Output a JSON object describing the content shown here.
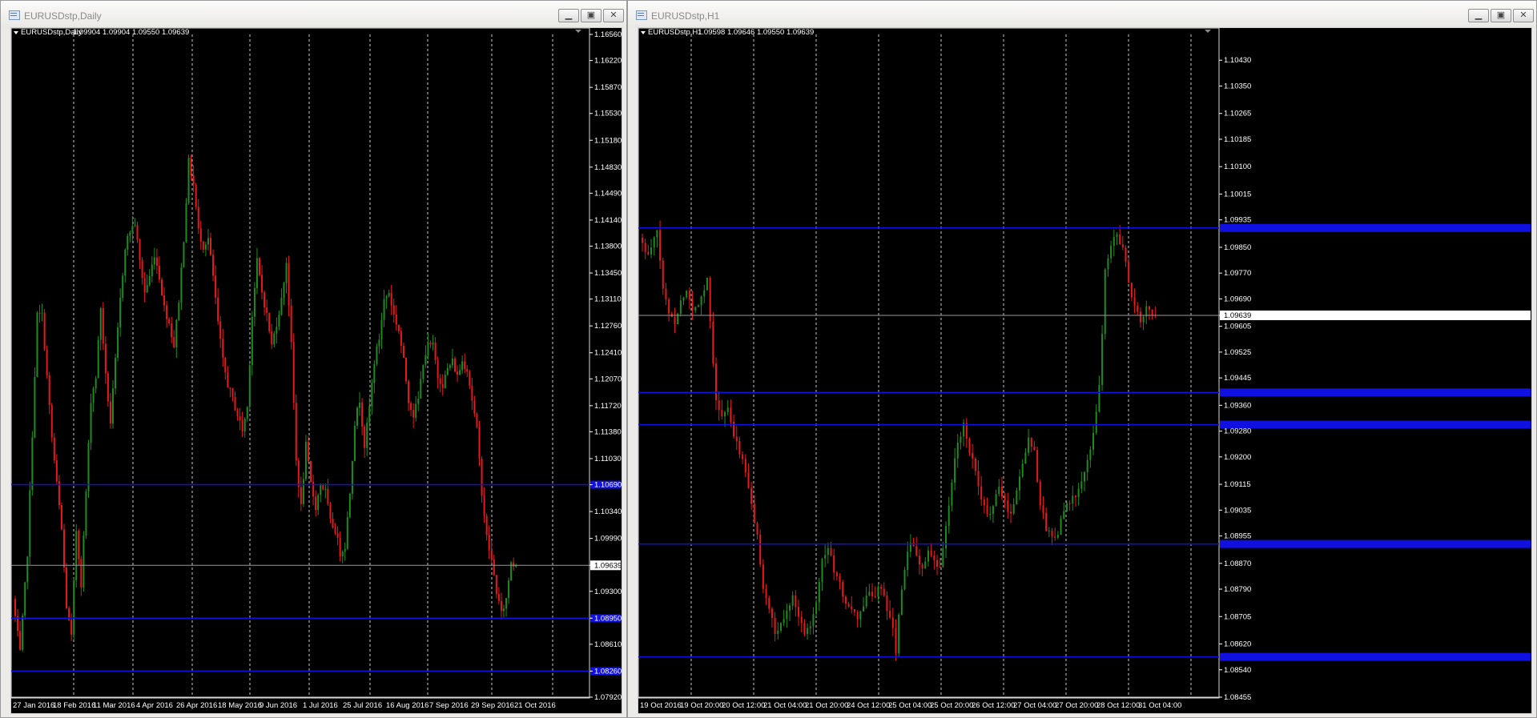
{
  "colors": {
    "bg": "#000000",
    "grid": "#c8c8c8",
    "bull": "#1f8c1f",
    "bear": "#e8191a",
    "level": "#1010e0",
    "axis_text": "#ffffff",
    "price_line": "#9a9a9a"
  },
  "icons": {
    "window": "chart-window-icon",
    "minimize": "minimize-icon",
    "maximize": "maximize-icon",
    "close": "close-icon",
    "menu": "triangle-down-icon",
    "scroll": "chart-shift-icon"
  },
  "windows": [
    {
      "title": "EURUSDstp,Daily",
      "header_symbol": "EURUSDstp,Daily",
      "header_prices": "1.09904 1.09904 1.09550 1.09639"
    },
    {
      "title": "EURUSDstp,H1",
      "header_symbol": "EURUSDstp,H1",
      "header_prices": "1.09598 1.09646 1.09550 1.09639"
    }
  ],
  "chart_data": [
    {
      "type": "candlestick",
      "symbol": "EURUSDstp",
      "timeframe": "Daily",
      "y_ticks": [
        "1.16560",
        "1.16220",
        "1.15870",
        "1.15530",
        "1.15180",
        "1.14830",
        "1.14490",
        "1.14140",
        "1.13800",
        "1.13450",
        "1.13110",
        "1.12760",
        "1.12410",
        "1.12070",
        "1.11720",
        "1.11380",
        "1.11030",
        "1.10690",
        "1.10340",
        "1.09990",
        "1.09639",
        "1.09300",
        "1.08950",
        "1.08610",
        "1.08260",
        "1.07920"
      ],
      "x_ticks": [
        "27 Jan 2016",
        "18 Feb 2016",
        "11 Mar 2016",
        "4 Apr 2016",
        "26 Apr 2016",
        "18 May 2016",
        "9 Jun 2016",
        "1 Jul 2016",
        "25 Jul 2016",
        "16 Aug 2016",
        "7 Sep 2016",
        "29 Sep 2016",
        "21 Oct 2016"
      ],
      "ylim": [
        1.0792,
        1.1656
      ],
      "current_price": 1.09639,
      "levels": [
        1.1069,
        1.0895,
        1.0826
      ],
      "path": [
        [
          0,
          1.092
        ],
        [
          3,
          1.085
        ],
        [
          6,
          1.098
        ],
        [
          10,
          1.129
        ],
        [
          12,
          1.129
        ],
        [
          16,
          1.113
        ],
        [
          20,
          1.101
        ],
        [
          22,
          1.091
        ],
        [
          24,
          1.087
        ],
        [
          26,
          1.101
        ],
        [
          28,
          1.094
        ],
        [
          30,
          1.106
        ],
        [
          32,
          1.118
        ],
        [
          34,
          1.121
        ],
        [
          36,
          1.13
        ],
        [
          38,
          1.121
        ],
        [
          40,
          1.115
        ],
        [
          42,
          1.123
        ],
        [
          44,
          1.131
        ],
        [
          46,
          1.138
        ],
        [
          48,
          1.14
        ],
        [
          50,
          1.141
        ],
        [
          52,
          1.136
        ],
        [
          54,
          1.132
        ],
        [
          56,
          1.134
        ],
        [
          58,
          1.137
        ],
        [
          60,
          1.134
        ],
        [
          62,
          1.13
        ],
        [
          64,
          1.128
        ],
        [
          66,
          1.125
        ],
        [
          68,
          1.131
        ],
        [
          70,
          1.139
        ],
        [
          72,
          1.149
        ],
        [
          74,
          1.146
        ],
        [
          76,
          1.14
        ],
        [
          78,
          1.138
        ],
        [
          80,
          1.139
        ],
        [
          82,
          1.134
        ],
        [
          84,
          1.128
        ],
        [
          86,
          1.123
        ],
        [
          88,
          1.12
        ],
        [
          90,
          1.118
        ],
        [
          92,
          1.116
        ],
        [
          94,
          1.114
        ],
        [
          96,
          1.117
        ],
        [
          98,
          1.129
        ],
        [
          100,
          1.136
        ],
        [
          102,
          1.132
        ],
        [
          104,
          1.129
        ],
        [
          106,
          1.125
        ],
        [
          108,
          1.128
        ],
        [
          110,
          1.131
        ],
        [
          112,
          1.136
        ],
        [
          114,
          1.125
        ],
        [
          116,
          1.11
        ],
        [
          118,
          1.104
        ],
        [
          120,
          1.112
        ],
        [
          122,
          1.107
        ],
        [
          124,
          1.104
        ],
        [
          126,
          1.107
        ],
        [
          128,
          1.106
        ],
        [
          130,
          1.102
        ],
        [
          132,
          1.101
        ],
        [
          134,
          1.098
        ],
        [
          136,
          1.099
        ],
        [
          138,
          1.106
        ],
        [
          140,
          1.115
        ],
        [
          142,
          1.118
        ],
        [
          144,
          1.112
        ],
        [
          146,
          1.117
        ],
        [
          148,
          1.123
        ],
        [
          150,
          1.126
        ],
        [
          152,
          1.131
        ],
        [
          154,
          1.132
        ],
        [
          156,
          1.129
        ],
        [
          158,
          1.127
        ],
        [
          160,
          1.123
        ],
        [
          162,
          1.118
        ],
        [
          164,
          1.116
        ],
        [
          166,
          1.118
        ],
        [
          168,
          1.123
        ],
        [
          170,
          1.125
        ],
        [
          172,
          1.125
        ],
        [
          174,
          1.121
        ],
        [
          176,
          1.12
        ],
        [
          178,
          1.122
        ],
        [
          180,
          1.123
        ],
        [
          182,
          1.121
        ],
        [
          184,
          1.123
        ],
        [
          186,
          1.122
        ],
        [
          188,
          1.118
        ],
        [
          190,
          1.114
        ],
        [
          192,
          1.106
        ],
        [
          194,
          1.1
        ],
        [
          196,
          1.097
        ],
        [
          198,
          1.093
        ],
        [
          200,
          1.09
        ],
        [
          202,
          1.092
        ],
        [
          204,
          1.097
        ],
        [
          205,
          1.0964
        ]
      ]
    },
    {
      "type": "candlestick",
      "symbol": "EURUSDstp",
      "timeframe": "H1",
      "y_ticks": [
        "1.10430",
        "1.10350",
        "1.10265",
        "1.10185",
        "1.10100",
        "1.10015",
        "1.09935",
        "1.09850",
        "1.09770",
        "1.09690",
        "1.09639",
        "1.09605",
        "1.09525",
        "1.09445",
        "1.09360",
        "1.09280",
        "1.09200",
        "1.09115",
        "1.09035",
        "1.08955",
        "1.08870",
        "1.08790",
        "1.08705",
        "1.08620",
        "1.08540",
        "1.08455"
      ],
      "x_ticks": [
        "19 Oct 2016",
        "19 Oct 20:00",
        "20 Oct 12:00",
        "21 Oct 04:00",
        "21 Oct 20:00",
        "24 Oct 12:00",
        "25 Oct 04:00",
        "25 Oct 20:00",
        "26 Oct 12:00",
        "27 Oct 04:00",
        "27 Oct 20:00",
        "28 Oct 12:00",
        "31 Oct 04:00"
      ],
      "ylim": [
        1.08455,
        1.1051
      ],
      "current_price": 1.09639,
      "levels": [
        1.0991,
        1.094,
        1.093,
        1.0893,
        1.0858
      ],
      "path": [
        [
          0,
          1.0988
        ],
        [
          3,
          1.0982
        ],
        [
          6,
          1.099
        ],
        [
          8,
          1.0972
        ],
        [
          10,
          1.0965
        ],
        [
          12,
          1.0962
        ],
        [
          14,
          1.0968
        ],
        [
          16,
          1.0972
        ],
        [
          18,
          1.0965
        ],
        [
          20,
          1.0968
        ],
        [
          22,
          1.0972
        ],
        [
          23,
          1.0976
        ],
        [
          24,
          1.0962
        ],
        [
          26,
          1.0938
        ],
        [
          28,
          1.0932
        ],
        [
          30,
          1.0935
        ],
        [
          32,
          1.0926
        ],
        [
          34,
          1.0922
        ],
        [
          36,
          1.0915
        ],
        [
          38,
          1.0905
        ],
        [
          40,
          1.0895
        ],
        [
          42,
          1.088
        ],
        [
          44,
          1.0873
        ],
        [
          46,
          1.0865
        ],
        [
          48,
          1.0868
        ],
        [
          50,
          1.0872
        ],
        [
          52,
          1.0878
        ],
        [
          54,
          1.087
        ],
        [
          56,
          1.0866
        ],
        [
          58,
          1.0868
        ],
        [
          60,
          1.0876
        ],
        [
          62,
          1.0888
        ],
        [
          64,
          1.0892
        ],
        [
          66,
          1.0885
        ],
        [
          68,
          1.088
        ],
        [
          70,
          1.0875
        ],
        [
          72,
          1.0872
        ],
        [
          74,
          1.087
        ],
        [
          76,
          1.0874
        ],
        [
          78,
          1.0878
        ],
        [
          80,
          1.0877
        ],
        [
          82,
          1.088
        ],
        [
          84,
          1.0872
        ],
        [
          86,
          1.0866
        ],
        [
          87,
          1.086
        ],
        [
          88,
          1.087
        ],
        [
          90,
          1.0886
        ],
        [
          92,
          1.0893
        ],
        [
          94,
          1.089
        ],
        [
          96,
          1.0885
        ],
        [
          98,
          1.089
        ],
        [
          100,
          1.0887
        ],
        [
          102,
          1.0885
        ],
        [
          104,
          1.0898
        ],
        [
          106,
          1.0912
        ],
        [
          108,
          1.0925
        ],
        [
          110,
          1.093
        ],
        [
          112,
          1.0922
        ],
        [
          114,
          1.0915
        ],
        [
          116,
          1.0906
        ],
        [
          118,
          1.0902
        ],
        [
          120,
          1.0905
        ],
        [
          122,
          1.091
        ],
        [
          124,
          1.0906
        ],
        [
          126,
          1.0902
        ],
        [
          128,
          1.091
        ],
        [
          130,
          1.0918
        ],
        [
          132,
          1.0926
        ],
        [
          134,
          1.0922
        ],
        [
          136,
          1.0905
        ],
        [
          138,
          1.0898
        ],
        [
          140,
          1.0895
        ],
        [
          142,
          1.0897
        ],
        [
          144,
          1.0903
        ],
        [
          146,
          1.0906
        ],
        [
          148,
          1.0908
        ],
        [
          150,
          1.0912
        ],
        [
          152,
          1.0918
        ],
        [
          154,
          1.0928
        ],
        [
          156,
          1.0942
        ],
        [
          157,
          1.0958
        ],
        [
          158,
          1.0978
        ],
        [
          160,
          1.0985
        ],
        [
          162,
          1.099
        ],
        [
          164,
          1.0984
        ],
        [
          166,
          1.0975
        ],
        [
          168,
          1.0966
        ],
        [
          170,
          1.0962
        ],
        [
          172,
          1.0966
        ],
        [
          174,
          1.0964
        ]
      ]
    }
  ]
}
